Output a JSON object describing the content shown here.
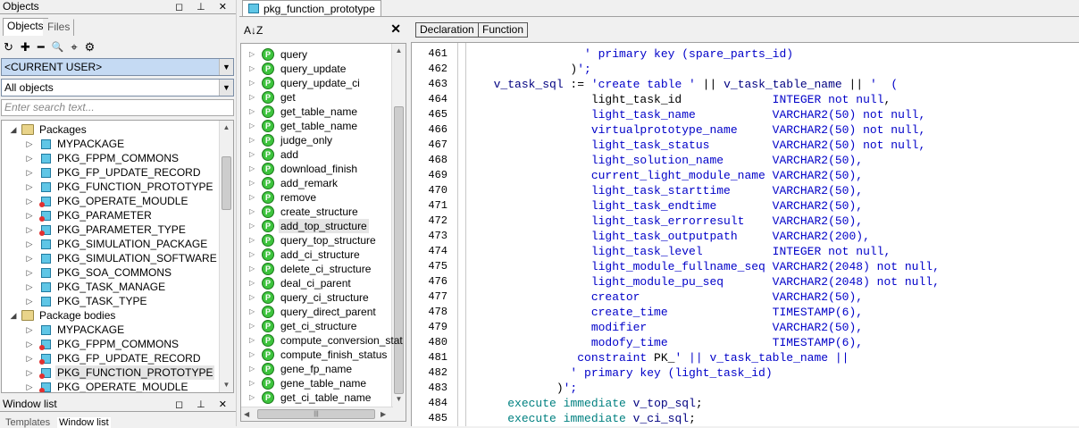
{
  "left_panel": {
    "title": "Objects",
    "title_buttons": "◻ ⊥ ✕",
    "tabs": [
      {
        "label": "Objects"
      },
      {
        "label": "Files"
      }
    ],
    "toolbar_icons": [
      "refresh-icon",
      "add-icon",
      "remove-icon",
      "find-icon",
      "filter-icon",
      "filter-settings-icon"
    ],
    "toolbar_glyphs": [
      "↻",
      "✚",
      "━",
      "🔍",
      "⌖",
      "⚙"
    ],
    "user_combo": "<CURRENT USER>",
    "objects_combo": "All objects",
    "search_placeholder": "Enter search text...",
    "tree": {
      "packages_label": "Packages",
      "packages": [
        "MYPACKAGE",
        "PKG_FPPM_COMMONS",
        "PKG_FP_UPDATE_RECORD",
        "PKG_FUNCTION_PROTOTYPE",
        "PKG_OPERATE_MOUDLE",
        "PKG_PARAMETER",
        "PKG_PARAMETER_TYPE",
        "PKG_SIMULATION_PACKAGE",
        "PKG_SIMULATION_SOFTWARE",
        "PKG_SOA_COMMONS",
        "PKG_TASK_MANAGE",
        "PKG_TASK_TYPE"
      ],
      "bodies_label": "Package bodies",
      "bodies": [
        "MYPACKAGE",
        "PKG_FPPM_COMMONS",
        "PKG_FP_UPDATE_RECORD",
        "PKG_FUNCTION_PROTOTYPE",
        "PKG_OPERATE_MOUDLE"
      ]
    },
    "window_list_title": "Window list",
    "window_list_tabs": [
      "Templates",
      "Window list"
    ]
  },
  "document_tab": "pkg_function_prototype",
  "procedure_panel": {
    "sort_glyph": "A↓Z",
    "close_glyph": "✕",
    "items": [
      "query",
      "query_update",
      "query_update_ci",
      "get",
      "get_table_name",
      "get_table_name",
      "judge_only",
      "add",
      "download_finish",
      "add_remark",
      "remove",
      "create_structure",
      "add_top_structure",
      "query_top_structure",
      "add_ci_structure",
      "delete_ci_structure",
      "deal_ci_parent",
      "query_ci_structure",
      "query_direct_parent",
      "get_ci_structure",
      "compute_conversion_stat",
      "compute_finish_status",
      "gene_fp_name",
      "gene_table_name",
      "get_ci_table_name"
    ],
    "selected": "add_top_structure"
  },
  "editor": {
    "tabs": [
      "Declaration",
      "Function"
    ],
    "lines": [
      {
        "n": "461",
        "t": "               ' primary key (spare_parts_id)"
      },
      {
        "n": "462",
        "t": "             )';"
      },
      {
        "n": "463",
        "t": "  v_task_sql := 'create table ' || v_task_table_name || '  ("
      },
      {
        "n": "464",
        "t": "                light_task_id             INTEGER not null,"
      },
      {
        "n": "465",
        "t": "                light_task_name           VARCHAR2(50) not null,"
      },
      {
        "n": "466",
        "t": "                virtualprototype_name     VARCHAR2(50) not null,"
      },
      {
        "n": "467",
        "t": "                light_task_status         VARCHAR2(50) not null,"
      },
      {
        "n": "468",
        "t": "                light_solution_name       VARCHAR2(50),"
      },
      {
        "n": "469",
        "t": "                current_light_module_name VARCHAR2(50),"
      },
      {
        "n": "470",
        "t": "                light_task_starttime      VARCHAR2(50),"
      },
      {
        "n": "471",
        "t": "                light_task_endtime        VARCHAR2(50),"
      },
      {
        "n": "472",
        "t": "                light_task_errorresult    VARCHAR2(50),"
      },
      {
        "n": "473",
        "t": "                light_task_outputpath     VARCHAR2(200),"
      },
      {
        "n": "474",
        "t": "                light_task_level          INTEGER not null,"
      },
      {
        "n": "475",
        "t": "                light_module_fullname_seq VARCHAR2(2048) not null,"
      },
      {
        "n": "476",
        "t": "                light_module_pu_seq       VARCHAR2(2048) not null,"
      },
      {
        "n": "477",
        "t": "                creator                   VARCHAR2(50),"
      },
      {
        "n": "478",
        "t": "                create_time               TIMESTAMP(6),"
      },
      {
        "n": "479",
        "t": "                modifier                  VARCHAR2(50),"
      },
      {
        "n": "480",
        "t": "                modofy_time               TIMESTAMP(6),"
      },
      {
        "n": "481",
        "t": "              constraint PK_' || v_task_table_name ||"
      },
      {
        "n": "482",
        "t": "             ' primary key (light_task_id)"
      },
      {
        "n": "483",
        "t": "           )';"
      },
      {
        "n": "484",
        "t": "    execute immediate v_top_sql;"
      },
      {
        "n": "485",
        "t": "    execute immediate v_ci_sql;"
      }
    ]
  },
  "colors": {
    "code_keyword": "#0000c8",
    "code_variable": "#000080",
    "code_execute": "#008080",
    "selection_highlight": "#c5daf3",
    "package_icon": "#5fc6e6",
    "procedure_icon": "#3ec43e"
  }
}
